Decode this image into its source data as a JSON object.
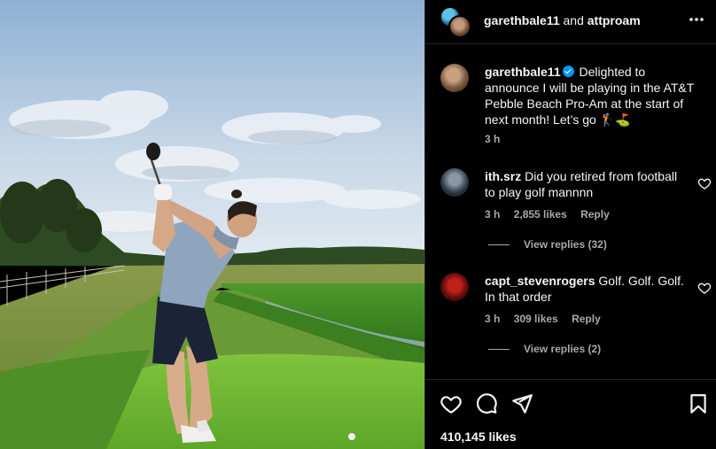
{
  "post": {
    "photo_alt": "Golfer teeing off on a green fairway",
    "header": {
      "user1": "garethbale11",
      "and_text": "and",
      "user2": "attproam",
      "more_icon": "more-horizontal-icon"
    },
    "caption": {
      "user": "garethbale11",
      "verified": true,
      "text": "Delighted to announce I will be playing in the AT&T Pebble Beach Pro-Am at the start of next month! Let’s go 🏌️⛳",
      "time": "3 h"
    },
    "comments": [
      {
        "user": "ith.srz",
        "text": "Did you retired from football to play golf mannnn",
        "time": "3 h",
        "likes": "2,855 likes",
        "reply": "Reply",
        "view_replies": "View replies (32)"
      },
      {
        "user": "capt_stevenrogers",
        "text": "Golf. Golf. Golf. In that order",
        "time": "3 h",
        "likes": "309 likes",
        "reply": "Reply",
        "view_replies": "View replies (2)"
      }
    ],
    "actions": {
      "like_icon": "heart-icon",
      "comment_icon": "comment-icon",
      "share_icon": "send-icon",
      "save_icon": "bookmark-icon"
    },
    "likes_count": "410,145 likes",
    "colors": {
      "background": "#000000",
      "text": "#f5f5f5",
      "secondary_text": "#a8a8a8",
      "verified": "#0095f6",
      "divider": "#262626"
    }
  }
}
